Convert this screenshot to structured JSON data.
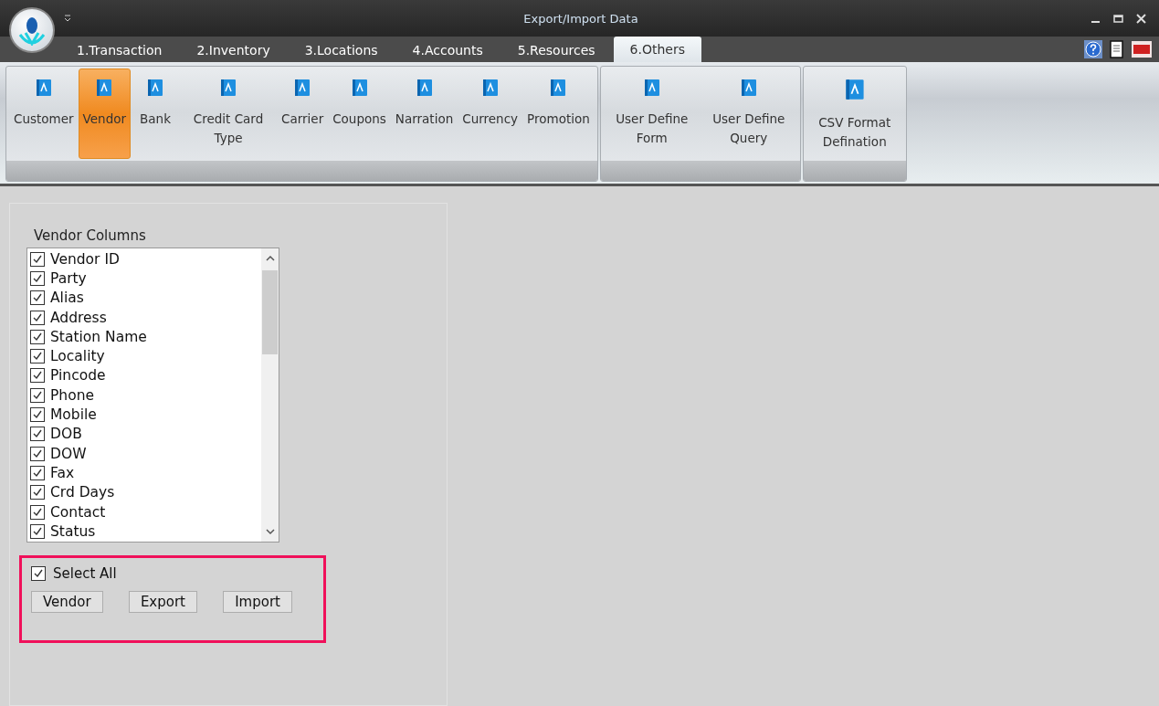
{
  "window": {
    "title": "Export/Import Data"
  },
  "tabs": [
    {
      "label": "1.Transaction",
      "selected": false
    },
    {
      "label": "2.Inventory",
      "selected": false
    },
    {
      "label": "3.Locations",
      "selected": false
    },
    {
      "label": "4.Accounts",
      "selected": false
    },
    {
      "label": "5.Resources",
      "selected": false
    },
    {
      "label": "6.Others",
      "selected": true
    }
  ],
  "ribbon_groups": [
    {
      "items": [
        {
          "label": "Customer",
          "selected": false
        },
        {
          "label": "Vendor",
          "selected": true
        },
        {
          "label": "Bank",
          "selected": false
        },
        {
          "label": "Credit Card Type",
          "selected": false
        },
        {
          "label": "Carrier",
          "selected": false
        },
        {
          "label": "Coupons",
          "selected": false
        },
        {
          "label": "Narration",
          "selected": false
        },
        {
          "label": "Currency",
          "selected": false
        },
        {
          "label": "Promotion",
          "selected": false
        }
      ]
    },
    {
      "items": [
        {
          "label": "User Define Form",
          "selected": false
        },
        {
          "label": "User Define Query",
          "selected": false
        }
      ]
    },
    {
      "items": [
        {
          "label": "CSV Format Defination",
          "selected": false
        }
      ]
    }
  ],
  "columns_list": {
    "title": "Vendor Columns",
    "items": [
      {
        "label": "Vendor ID",
        "checked": true
      },
      {
        "label": "Party",
        "checked": true
      },
      {
        "label": "Alias",
        "checked": true
      },
      {
        "label": "Address",
        "checked": true
      },
      {
        "label": "Station Name",
        "checked": true
      },
      {
        "label": "Locality",
        "checked": true
      },
      {
        "label": "Pincode",
        "checked": true
      },
      {
        "label": "Phone",
        "checked": true
      },
      {
        "label": "Mobile",
        "checked": true
      },
      {
        "label": "DOB",
        "checked": true
      },
      {
        "label": "DOW",
        "checked": true
      },
      {
        "label": "Fax",
        "checked": true
      },
      {
        "label": "Crd Days",
        "checked": true
      },
      {
        "label": "Contact",
        "checked": true
      },
      {
        "label": "Status",
        "checked": true
      }
    ]
  },
  "select_all": {
    "label": "Select All",
    "checked": true
  },
  "buttons": [
    "Vendor",
    "Export",
    "Import"
  ]
}
